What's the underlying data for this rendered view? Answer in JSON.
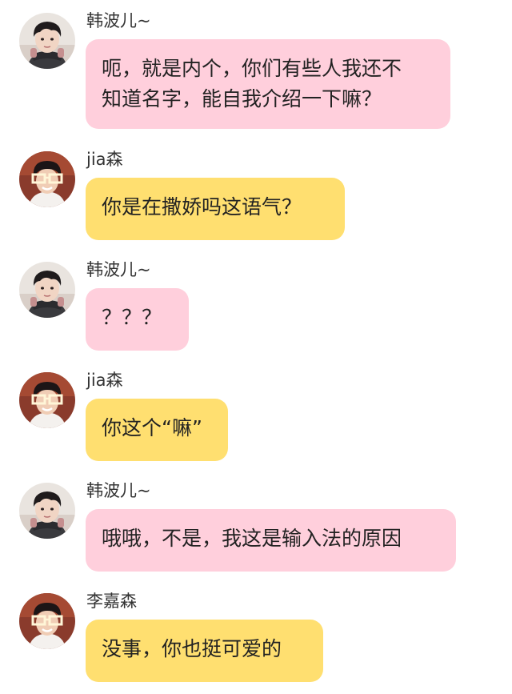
{
  "colors": {
    "pink_bubble": "#ffcfdc",
    "yellow_bubble": "#ffdf70",
    "text": "#222222",
    "sender_text": "#333333"
  },
  "messages": [
    {
      "sender": "韩波儿~",
      "avatar_icon": "boy-with-headphones-avatar-icon",
      "lines": [
        "呃，就是内个，你们有些人我还不",
        "知道名字，能自我介绍一下嘛？"
      ],
      "bubble_color": "pink"
    },
    {
      "sender": "jia森",
      "avatar_icon": "boy-with-white-glasses-avatar-icon",
      "lines": [
        "你是在撒娇吗这语气？"
      ],
      "bubble_color": "yellow"
    },
    {
      "sender": "韩波儿~",
      "avatar_icon": "boy-with-headphones-avatar-icon",
      "lines": [
        "？？？"
      ],
      "bubble_color": "pink"
    },
    {
      "sender": "jia森",
      "avatar_icon": "boy-with-white-glasses-avatar-icon",
      "lines": [
        "你这个“嘛”"
      ],
      "bubble_color": "yellow"
    },
    {
      "sender": "韩波儿~",
      "avatar_icon": "boy-with-headphones-avatar-icon",
      "lines": [
        "哦哦，不是，我这是输入法的原因"
      ],
      "bubble_color": "pink"
    },
    {
      "sender": "李嘉森",
      "avatar_icon": "boy-with-white-glasses-avatar-icon",
      "lines": [
        "没事，你也挺可爱的"
      ],
      "bubble_color": "yellow"
    }
  ]
}
